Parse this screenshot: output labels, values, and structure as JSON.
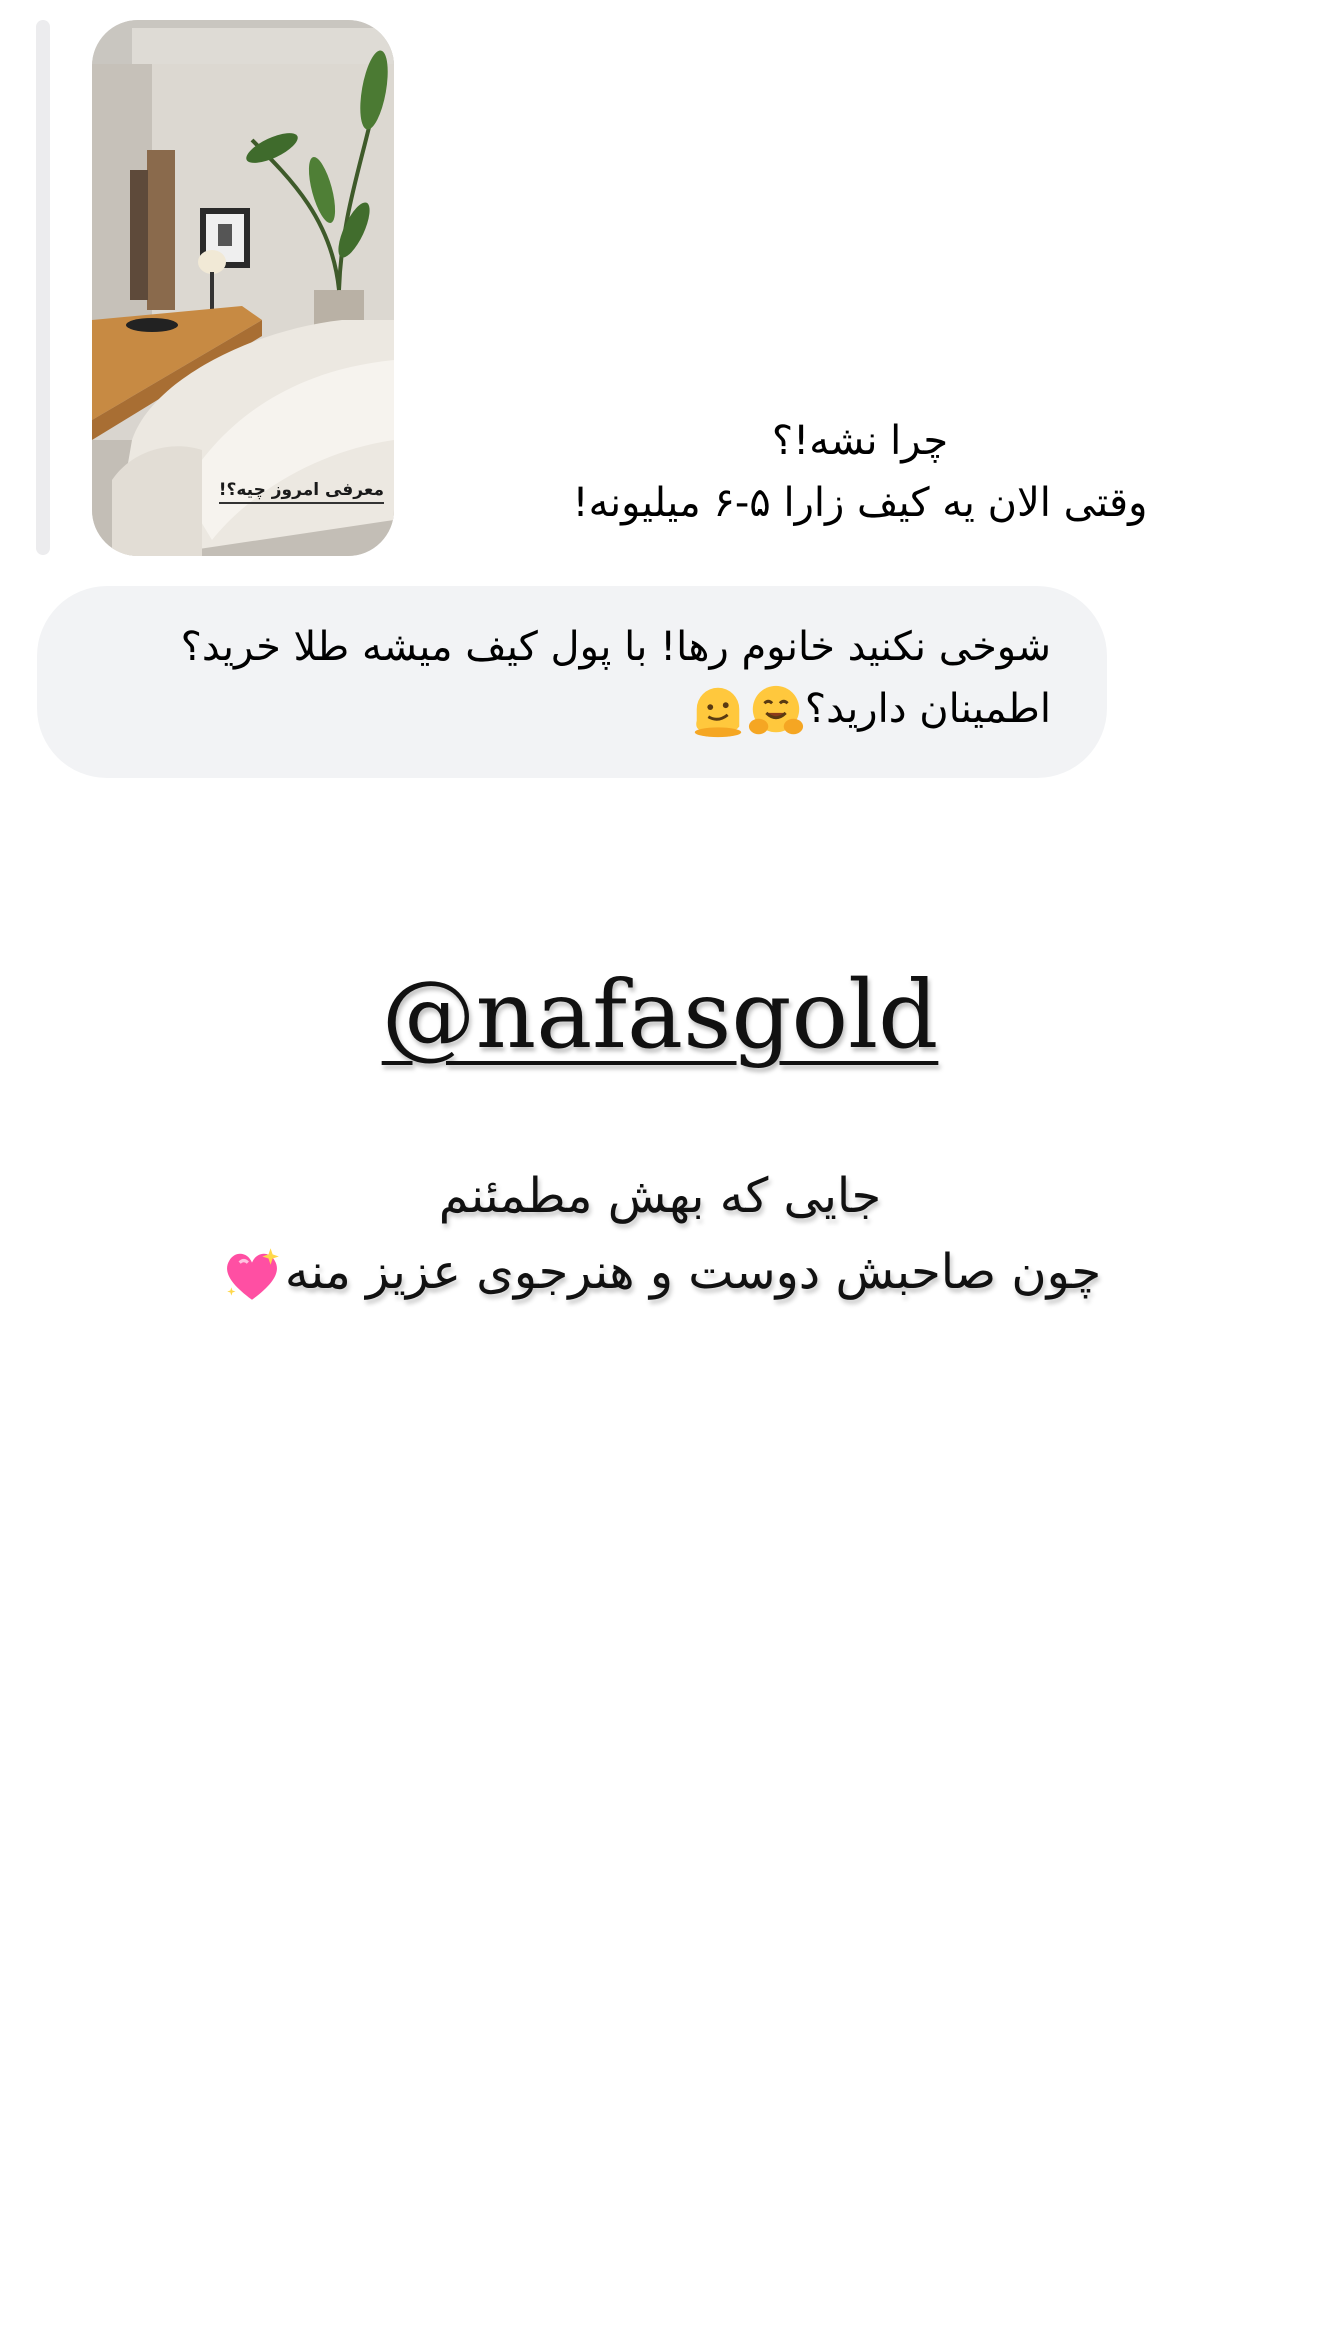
{
  "story_preview": {
    "caption": "معرفی امروز چیه؟!"
  },
  "story_reply": {
    "line1": "چرا نشه!؟",
    "line2": "وقتی الان یه کیف زارا ۵-۶ میلیونه!"
  },
  "message": {
    "line1": "شوخی نکنید خانوم رها! با پول کیف میشه طلا خرید؟",
    "line2": "اطمینان دارید؟",
    "emojis": [
      "hugging-face-emoji",
      "melting-face-emoji"
    ]
  },
  "handle": "@nafasgold",
  "caption": {
    "line1": "جایی که بهش مطمئنم",
    "line2": "چون صاحبش دوست و هنرجوی عزیز منه",
    "emoji": "sparkling-heart-emoji"
  },
  "colors": {
    "bubble_bg": "#f2f3f5",
    "quote_bar": "#ececee",
    "text": "#111111"
  }
}
